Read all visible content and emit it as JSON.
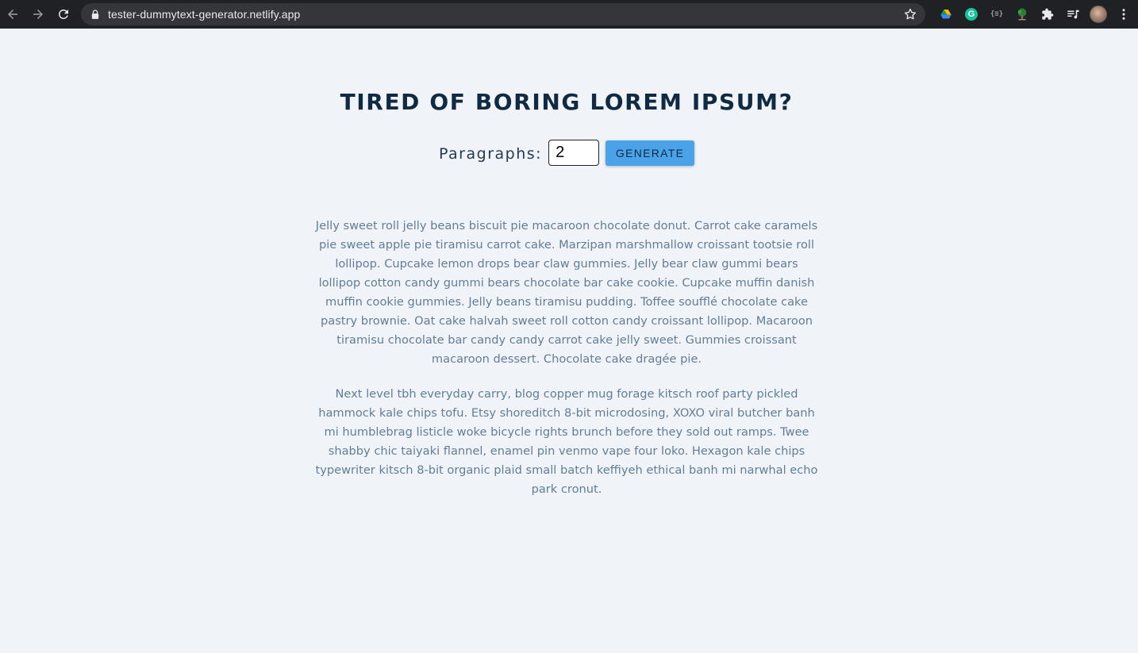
{
  "browser": {
    "url": "tester-dummytext-generator.netlify.app",
    "extensions": [
      {
        "name": "google-drive-icon"
      },
      {
        "name": "grammarly-icon",
        "text": "G"
      },
      {
        "name": "code-bracket-icon",
        "text": "{≡}"
      },
      {
        "name": "tree-icon"
      },
      {
        "name": "extensions-puzzle-icon"
      },
      {
        "name": "media-playlist-icon"
      },
      {
        "name": "profile-avatar"
      },
      {
        "name": "more-menu-icon"
      }
    ]
  },
  "page": {
    "title": "TIRED OF BORING LOREM IPSUM?",
    "form": {
      "label": "Paragraphs:",
      "count_value": "2",
      "button_label": "GENERATE"
    },
    "paragraphs": [
      "Jelly sweet roll jelly beans biscuit pie macaroon chocolate donut. Carrot cake caramels pie sweet apple pie tiramisu carrot cake. Marzipan marshmallow croissant tootsie roll lollipop. Cupcake lemon drops bear claw gummies. Jelly bear claw gummi bears lollipop cotton candy gummi bears chocolate bar cake cookie. Cupcake muffin danish muffin cookie gummies. Jelly beans tiramisu pudding. Toffee soufflé chocolate cake pastry brownie. Oat cake halvah sweet roll cotton candy croissant lollipop. Macaroon tiramisu chocolate bar candy candy carrot cake jelly sweet. Gummies croissant macaroon dessert. Chocolate cake dragée pie.",
      "Next level tbh everyday carry, blog copper mug forage kitsch roof party pickled hammock kale chips tofu. Etsy shoreditch 8-bit microdosing, XOXO viral butcher banh mi humblebrag listicle woke bicycle rights brunch before they sold out ramps. Twee shabby chic taiyaki flannel, enamel pin venmo vape four loko. Hexagon kale chips typewriter kitsch 8-bit organic plaid small batch keffiyeh ethical banh mi narwhal echo park cronut."
    ]
  },
  "colors": {
    "title": "#102a43",
    "label": "#243b53",
    "body_text": "#627d98",
    "background": "#f0f4f8",
    "button": "#4aa3e8"
  }
}
